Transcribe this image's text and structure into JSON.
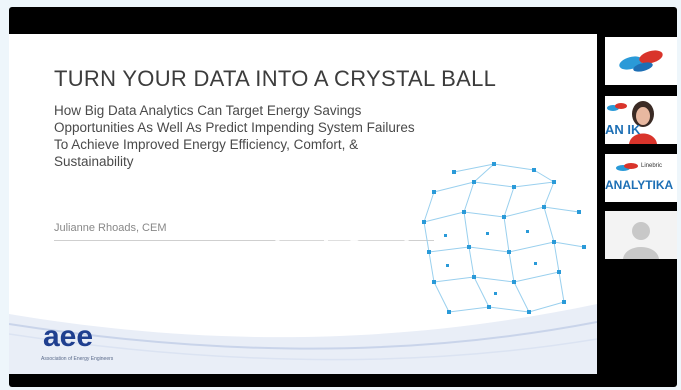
{
  "slide": {
    "title": "TURN YOUR DATA INTO A CRYSTAL BALL",
    "subtitle_lines": [
      "How Big Data Analytics Can Target Energy Savings",
      "Opportunities As Well As Predict Impending System Failures",
      "To Achieve Improved Energy Efficiency, Comfort, &",
      "Sustainability"
    ],
    "presenter": "Julianne Rhoads, CEM",
    "logo_text": "aee",
    "logo_subtext": "Association of Energy Engineers"
  },
  "sidebar": {
    "participants": [
      {
        "kind": "logo",
        "icon": "link-logo-icon"
      },
      {
        "kind": "video",
        "brand": "ANALYTIKA",
        "brand_visible": "AN   IK"
      },
      {
        "kind": "brand",
        "brand_small": "Linebric",
        "brand": "ANALYTIKA"
      },
      {
        "kind": "avatar",
        "icon": "user-avatar-icon"
      }
    ]
  },
  "colors": {
    "page_bg": "#eef6fb",
    "player_bg": "#000000",
    "accent_blue": "#1d6fb5",
    "accent_red": "#d9342b"
  },
  "overlay": {
    "icon": "play-icon"
  }
}
